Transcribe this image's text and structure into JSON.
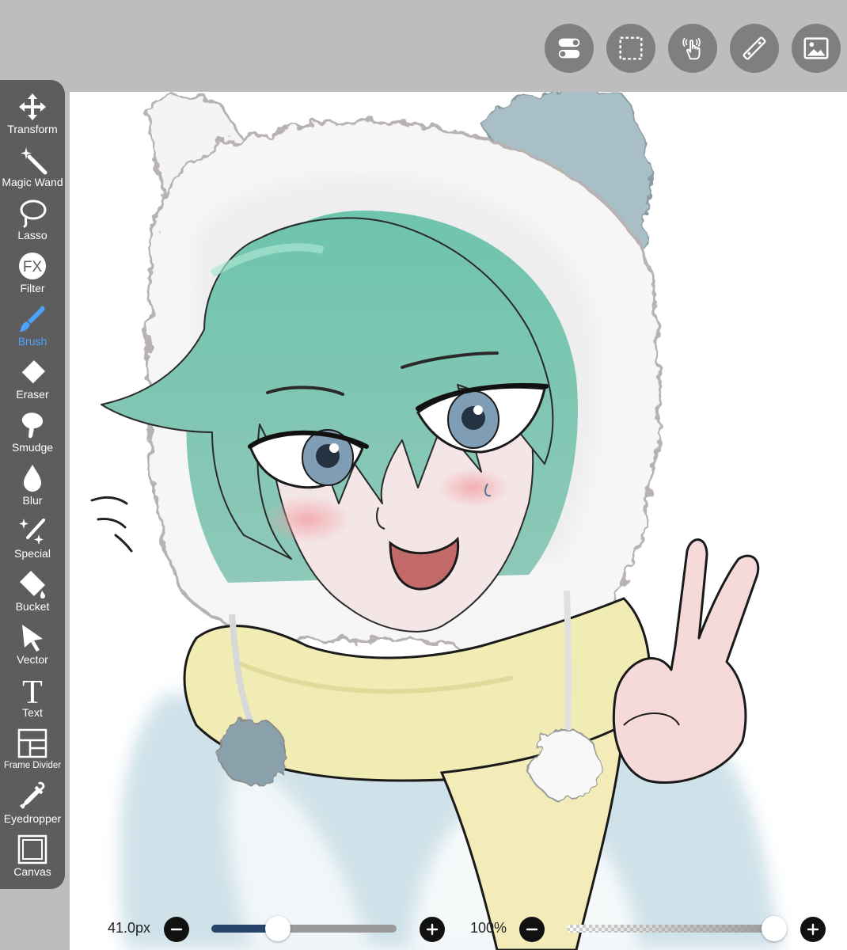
{
  "top_actions": [
    {
      "icon": "toggle-icon"
    },
    {
      "icon": "selection-icon"
    },
    {
      "icon": "hand-gesture-icon"
    },
    {
      "icon": "ruler-icon"
    },
    {
      "icon": "image-icon"
    }
  ],
  "tools": [
    {
      "label": "Transform",
      "icon": "transform-icon"
    },
    {
      "label": "Magic Wand",
      "icon": "magic-wand-icon"
    },
    {
      "label": "Lasso",
      "icon": "lasso-icon"
    },
    {
      "label": "Filter",
      "icon": "filter-fx-icon"
    },
    {
      "label": "Brush",
      "icon": "brush-icon",
      "active": true
    },
    {
      "label": "Eraser",
      "icon": "eraser-icon"
    },
    {
      "label": "Smudge",
      "icon": "smudge-icon"
    },
    {
      "label": "Blur",
      "icon": "blur-drop-icon"
    },
    {
      "label": "Special",
      "icon": "special-sparkle-icon"
    },
    {
      "label": "Bucket",
      "icon": "bucket-icon"
    },
    {
      "label": "Vector",
      "icon": "vector-arrow-icon"
    },
    {
      "label": "Text",
      "icon": "text-icon"
    },
    {
      "label": "Frame Divider",
      "icon": "frame-divider-icon"
    },
    {
      "label": "Eyedropper",
      "icon": "eyedropper-icon"
    },
    {
      "label": "Canvas",
      "icon": "canvas-icon"
    }
  ],
  "brush_size": {
    "value_label": "41.0px",
    "level": 0.36
  },
  "brush_opacity": {
    "value_label": "100%",
    "level": 1.0
  },
  "colors": {
    "accent": "#4aa3ff",
    "slider_fill": "#27456b",
    "panel": "#5d5d5d",
    "topbar": "#bdbdbd"
  }
}
